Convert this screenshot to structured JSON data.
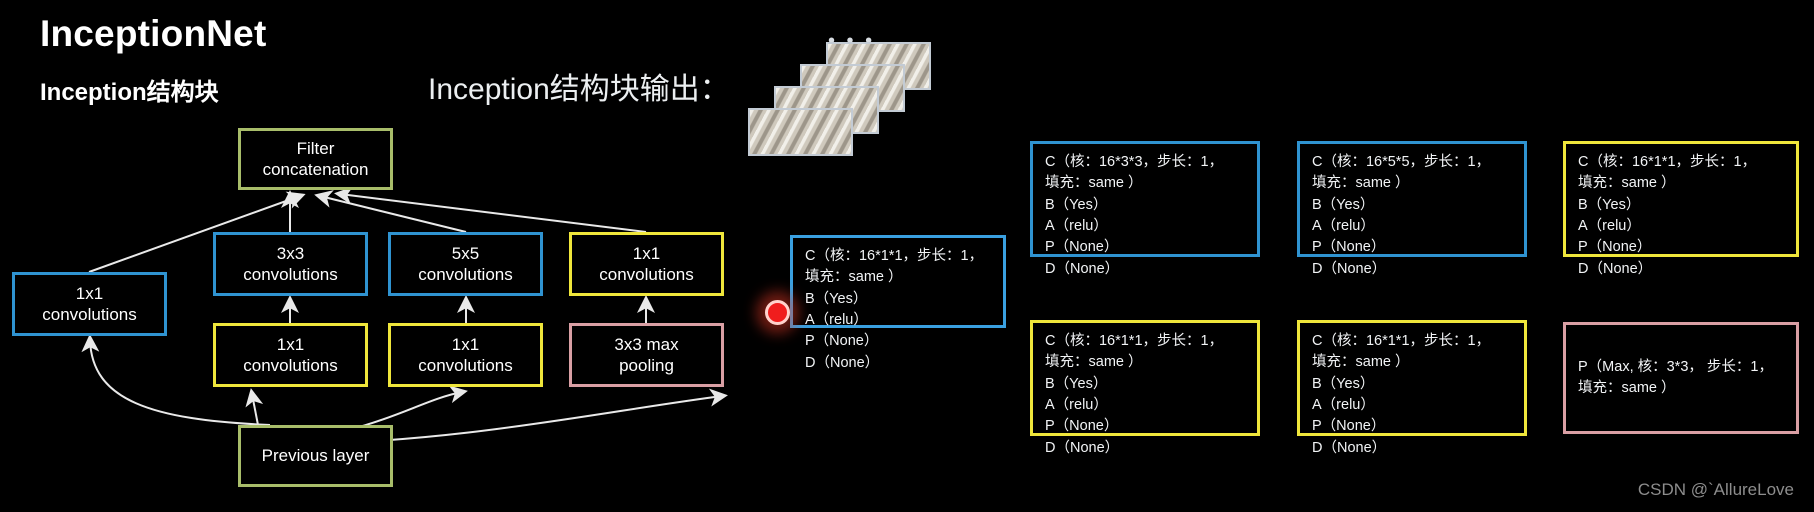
{
  "titles": {
    "main": "InceptionNet",
    "sub": "Inception结构块",
    "output": "Inception结构块输出："
  },
  "diagram": {
    "nodes": [
      {
        "id": "filter-concat",
        "label": "Filter\nconcatenation",
        "color": "#a8bd6a"
      },
      {
        "id": "1x1-left",
        "label": "1x1\nconvolutions",
        "color": "#2f93d1"
      },
      {
        "id": "3x3-conv",
        "label": "3x3\nconvolutions",
        "color": "#2f93d1"
      },
      {
        "id": "5x5-conv",
        "label": "5x5\nconvolutions",
        "color": "#2f93d1"
      },
      {
        "id": "1x1-right",
        "label": "1x1\nconvolutions",
        "color": "#efe63b"
      },
      {
        "id": "1x1-a",
        "label": "1x1\nconvolutions",
        "color": "#efe63b"
      },
      {
        "id": "1x1-b",
        "label": "1x1\nconvolutions",
        "color": "#efe63b"
      },
      {
        "id": "max-pooling",
        "label": "3x3 max\npooling",
        "color": "#d99fa4"
      },
      {
        "id": "previous-layer",
        "label": "Previous layer",
        "color": "#a8bd6a"
      }
    ]
  },
  "feature_maps": {
    "ellipsis": "• • •",
    "count": 4
  },
  "specs": {
    "center": "C（核：16*1*1，步长：1，\n      填充：same ）\nB（Yes）\nA（relu）\nP（None）\nD（None）",
    "r1c1": "C（核：16*3*3，步长：1，\n      填充：same ）\nB（Yes）\nA（relu）\nP（None）\nD（None）",
    "r1c2": "C（核：16*5*5，步长：1，\n      填充：same ）\nB（Yes）\nA（relu）\nP（None）\nD（None）",
    "r1c3": "C（核：16*1*1，步长：1，\n      填充：same ）\nB（Yes）\nA（relu）\nP（None）\nD（None）",
    "r2c1": "C（核：16*1*1，步长：1，\n      填充：same ）\nB（Yes）\nA（relu）\nP（None）\nD（None）",
    "r2c2": "C（核：16*1*1，步长：1，\n      填充：same ）\nB（Yes）\nA（relu）\nP（None）\nD（None）",
    "r2c3": "P（Max, 核：3*3， 步长：1，\n      填充：same ）"
  },
  "colors": {
    "blue": "#2f93d1",
    "yellow": "#efe63b",
    "green": "#a8bd6a",
    "pink": "#d99fa4",
    "marker_red": "#f01d1d",
    "background": "#000000"
  },
  "watermark": "CSDN @`AllureLove"
}
